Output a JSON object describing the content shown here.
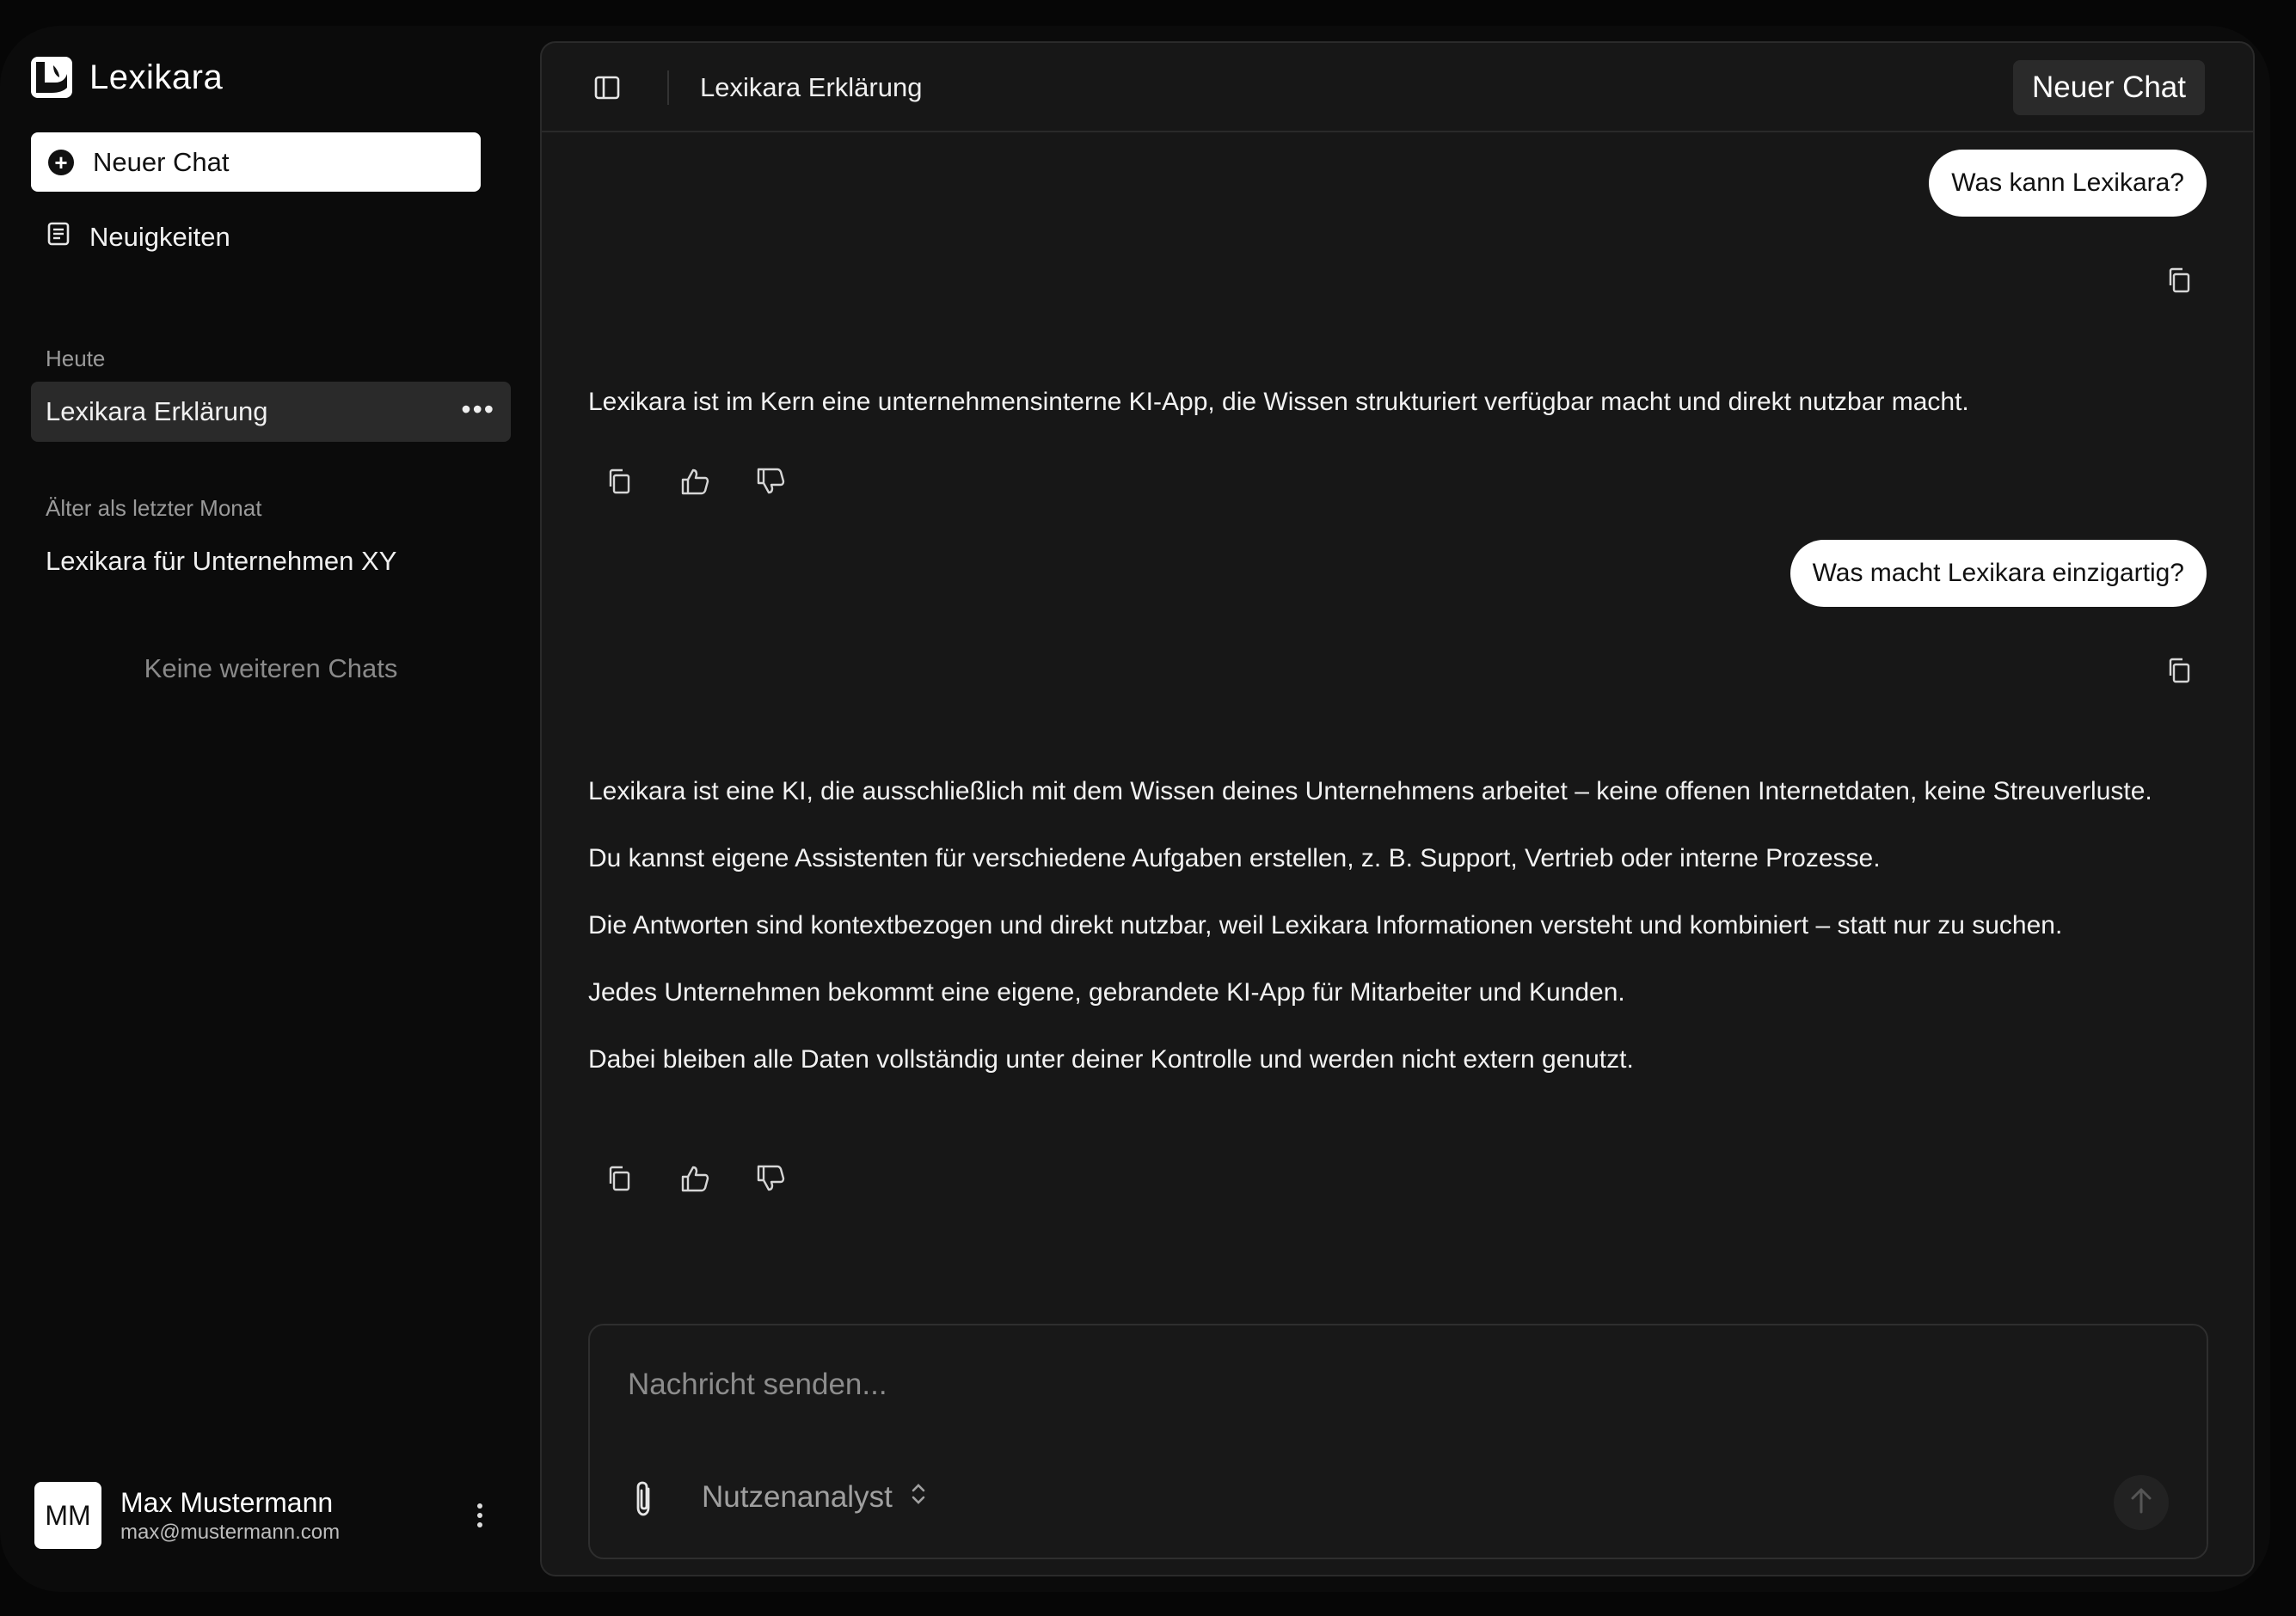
{
  "app": {
    "name": "Lexikara"
  },
  "sidebar": {
    "new_chat_label": "Neuer Chat",
    "news_label": "Neuigkeiten",
    "sections": [
      {
        "label": "Heute",
        "chats": [
          {
            "title": "Lexikara Erklärung",
            "active": true
          }
        ]
      },
      {
        "label": "Älter als letzter Monat",
        "chats": [
          {
            "title": "Lexikara für Unternehmen XY",
            "active": false
          }
        ]
      }
    ],
    "empty_note": "Keine weiteren Chats",
    "user": {
      "initials": "MM",
      "name": "Max Mustermann",
      "email": "max@mustermann.com"
    }
  },
  "topbar": {
    "title": "Lexikara Erklärung",
    "new_chat_label": "Neuer Chat"
  },
  "conversation": {
    "q1": "Was kann Lexikara?",
    "a1": "Lexikara ist im Kern eine unternehmensinterne KI-App, die Wissen strukturiert verfügbar macht und direkt nutzbar macht.",
    "q2": "Was macht Lexikara einzigartig?",
    "a2": [
      "Lexikara ist eine KI, die ausschließlich mit dem Wissen deines Unternehmens arbeitet – keine offenen Internetdaten, keine Streuverluste.",
      "Du kannst eigene Assistenten für verschiedene Aufgaben erstellen, z. B. Support, Vertrieb oder interne Prozesse.",
      "Die Antworten sind kontextbezogen und direkt nutzbar, weil Lexikara Informationen versteht und kombiniert – statt nur zu suchen.",
      "Jedes Unternehmen bekommt eine eigene, gebrandete KI-App für Mitarbeiter und Kunden.",
      "Dabei bleiben alle Daten vollständig unter deiner Kontrolle und werden nicht extern genutzt."
    ]
  },
  "composer": {
    "placeholder": "Nachricht senden...",
    "value": "",
    "assistant": "Nutzenanalyst"
  },
  "icons": {
    "copy": "copy-icon",
    "thumbs_up": "thumbs-up-icon",
    "thumbs_down": "thumbs-down-icon",
    "attach": "paperclip-icon",
    "send": "arrow-up-icon",
    "toggle": "sidebar-toggle-icon"
  }
}
